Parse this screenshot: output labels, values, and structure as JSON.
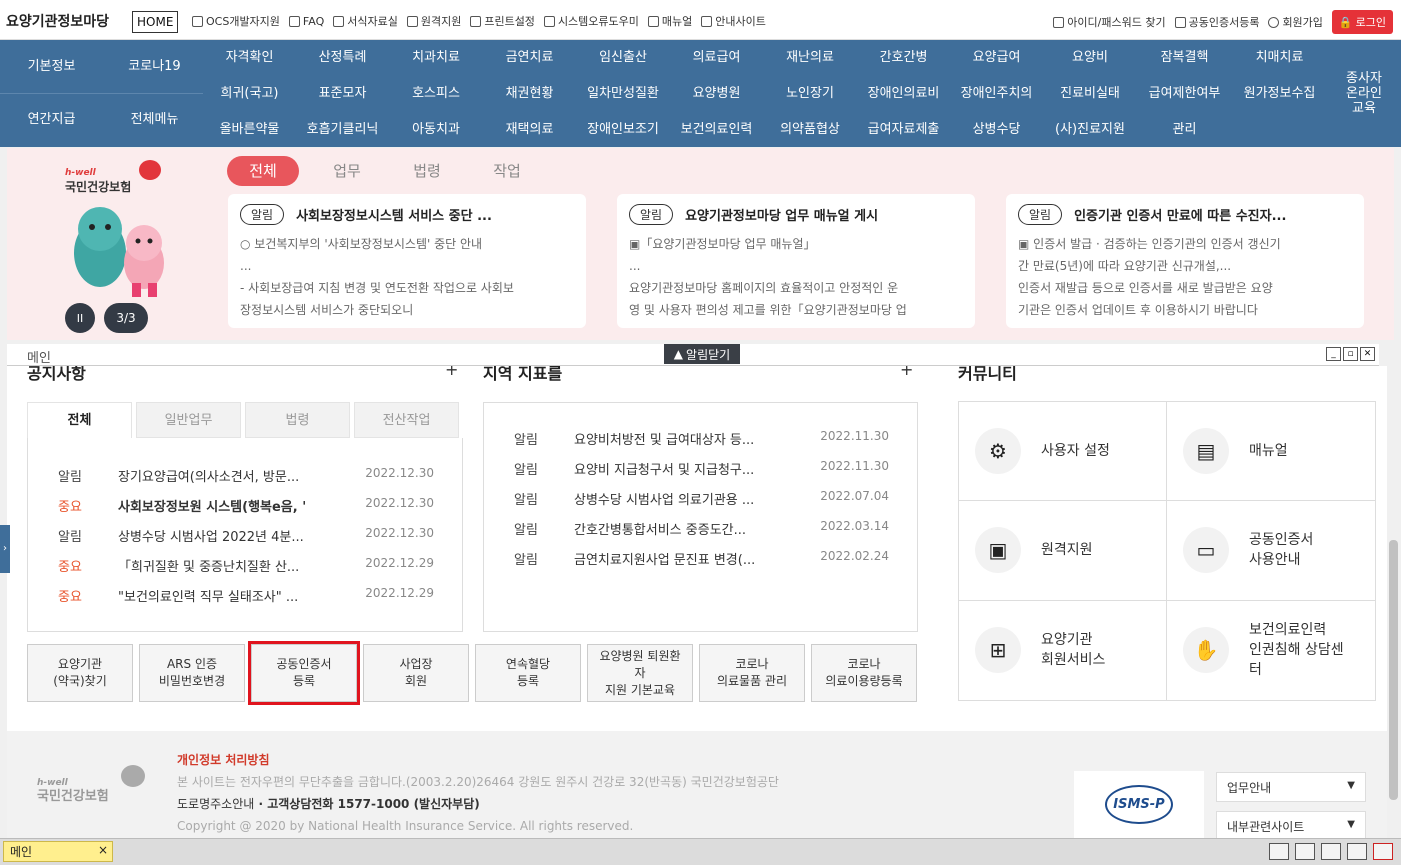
{
  "header": {
    "site_title": "요양기관정보마당",
    "home_label": "HOME",
    "utility_left": [
      "OCS개발자지원",
      "FAQ",
      "서식자료실",
      "원격지원",
      "프린트설정",
      "시스템오류도우미",
      "매뉴얼",
      "안내사이트"
    ],
    "utility_right": [
      "아이디/패스워드 찾기",
      "공동인증서등록",
      "회원가입"
    ],
    "login_label": "로그인"
  },
  "nav": {
    "left": [
      "기본정보",
      "코로나19",
      "연간지급",
      "전체메뉴"
    ],
    "row1": [
      "자격확인",
      "산정특례",
      "치과치료",
      "금연치료",
      "임신출산",
      "의료급여",
      "재난의료",
      "간호간병",
      "요양급여",
      "요양비",
      "잠복결핵",
      "치매치료"
    ],
    "row2": [
      "희귀(국고)",
      "표준모자",
      "호스피스",
      "채권현황",
      "일차만성질환",
      "요양병원",
      "노인장기",
      "장애인의료비",
      "장애인주치의",
      "진료비실태",
      "급여제한여부",
      "원가정보수집"
    ],
    "row3": [
      "올바른약물",
      "호흡기클리닉",
      "아동치과",
      "재택의료",
      "장애인보조기",
      "보건의료인력",
      "의약품협상",
      "급여자료제출",
      "상병수당",
      "(사)진료지원",
      "관리"
    ],
    "right": "종사자\n온라인\n교육"
  },
  "banner": {
    "logo_small": "h-well",
    "logo_text": "국민건강보험",
    "pause_label": "II",
    "pager": "3/3",
    "tabs": [
      "전체",
      "업무",
      "법령",
      "작업"
    ],
    "cards": [
      {
        "badge": "알림",
        "title": "사회보장정보시스템 서비스 중단 ...",
        "body": "  ○ 보건복지부의 '사회보장정보시스템' 중단 안내\n...\n  - 사회보장급여 지침 변경 및 연도전환 작업으로 사회보\n장정보시스템 서비스가 중단되오니"
      },
      {
        "badge": "알림",
        "title": "요양기관정보마당 업무 매뉴얼 게시",
        "body": "▣「요양기관정보마당 업무 매뉴얼」\n...\n요양기관정보마당 홈페이지의 효율적이고 안정적인 운\n영 및 사용자 편의성 제고를 위한「요양기관정보마당 업"
      },
      {
        "badge": "알림",
        "title": "인증기관 인증서 만료에 따른 수진자...",
        "body": "  ▣ 인증서 발급 · 검증하는 인증기관의 인증서 갱신기\n간 만료(5년)에 따라 요양기관 신규개설,...\n      인증서 재발급 등으로 인증서를 새로 발급받은 요양\n기관은 인증서 업데이트 후 이용하시기 바랍니다"
      }
    ]
  },
  "alarm_close": "알림닫기",
  "window": {
    "label": "메인"
  },
  "main": {
    "notice_title": "공지사항",
    "news_title": "지역 지표를",
    "community_title": "커뮤니티",
    "notice_tabs": [
      "전체",
      "일반업무",
      "법령",
      "전산작업"
    ],
    "notices": [
      {
        "type": "알림",
        "title": "장기요양급여(의사소견서, 방문...",
        "date": "2022.12.30",
        "important": false
      },
      {
        "type": "중요",
        "title": "사회보장정보원 시스템(행복e음, '",
        "date": "2022.12.30",
        "important": true
      },
      {
        "type": "알림",
        "title": "상병수당 시범사업 2022년 4분...",
        "date": "2022.12.30",
        "important": false
      },
      {
        "type": "중요",
        "title": "「희귀질환 및 중증난치질환 산...",
        "date": "2022.12.29",
        "important": true
      },
      {
        "type": "중요",
        "title": "\"보건의료인력 직무 실태조사\" ...",
        "date": "2022.12.29",
        "important": true
      }
    ],
    "news": [
      {
        "type": "알림",
        "title": "요양비처방전 및 급여대상자 등...",
        "date": "2022.11.30"
      },
      {
        "type": "알림",
        "title": "요양비 지급청구서 및 지급청구...",
        "date": "2022.11.30"
      },
      {
        "type": "알림",
        "title": "상병수당 시범사업 의료기관용 ...",
        "date": "2022.07.04"
      },
      {
        "type": "알림",
        "title": "간호간병통합서비스 중증도간...",
        "date": "2022.03.14"
      },
      {
        "type": "알림",
        "title": "금연치료지원사업 문진표 변경(...",
        "date": "2022.02.24"
      }
    ],
    "quick": [
      "요양기관\n(약국)찾기",
      "ARS 인증\n비밀번호변경",
      "공동인증서\n등록",
      "사업장\n회원",
      "연속혈당\n등록",
      "요양병원 퇴원환\n자\n지원 기본교육",
      "코로나\n의료물품 관리",
      "코로나\n의료이용량등록"
    ],
    "community": [
      {
        "label": "사용자 설정",
        "icon": "gear-icon"
      },
      {
        "label": "매뉴얼",
        "icon": "document-icon"
      },
      {
        "label": "원격지원",
        "icon": "remote-icon"
      },
      {
        "label": "공동인증서\n사용안내",
        "icon": "folder-icon"
      },
      {
        "label": "요양기관\n회원서비스",
        "icon": "member-icon"
      },
      {
        "label": "보건의료인력\n인권침해 상담센\n터",
        "icon": "hands-icon"
      }
    ]
  },
  "footer": {
    "logo_small": "h-well",
    "logo_text": "국민건강보험",
    "privacy": "개인정보 처리방침",
    "line1": "본 사이트는 전자우편의 무단추출을 금합니다.(2003.2.20)26464 강원도 원주시 건강로 32(반곡동) 국민건강보험공단",
    "line2a": "도로명주소안내",
    "line2b": " · 고객상담전화 1577-1000 (발신자부담)",
    "copyright": "Copyright @ 2020 by National Health Insurance Service. All rights reserved.",
    "isms": "ISMS-P",
    "select1": "업무안내",
    "select2": "내부관련사이트"
  },
  "taskbar": {
    "tab": "메인",
    "close": "×"
  },
  "colors": {
    "nav": "#3f6e9a",
    "accent": "#e8565c",
    "important": "#e8542c",
    "highlight": "#e0141e"
  }
}
